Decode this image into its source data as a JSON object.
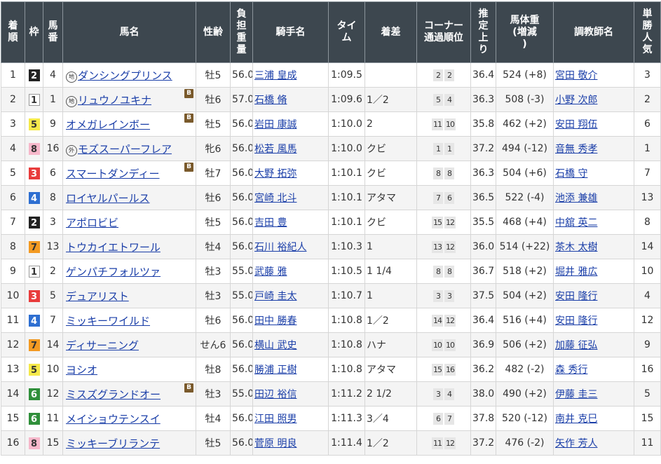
{
  "headers": {
    "rank": "着順",
    "frame": "枠",
    "number": "馬番",
    "horse": "馬名",
    "sex_age": "性齢",
    "weight": "負担重量",
    "jockey": "騎手名",
    "time": "タイム",
    "margin": "着差",
    "corner": "コーナー通過順位",
    "last3f": "推定上り",
    "body_weight": "馬体重(増減)",
    "trainer": "調教師名",
    "popularity": "単勝人気"
  },
  "frame_colors": {
    "1": {
      "bg": "#ffffff",
      "fg": "#333333",
      "border": "#999999"
    },
    "2": {
      "bg": "#222222",
      "fg": "#ffffff",
      "border": "#222222"
    },
    "3": {
      "bg": "#e83c3c",
      "fg": "#ffffff",
      "border": "#e83c3c"
    },
    "4": {
      "bg": "#2e6fd1",
      "fg": "#ffffff",
      "border": "#2e6fd1"
    },
    "5": {
      "bg": "#f5e94a",
      "fg": "#333333",
      "border": "#f5e94a"
    },
    "6": {
      "bg": "#2f8f3a",
      "fg": "#ffffff",
      "border": "#2f8f3a"
    },
    "7": {
      "bg": "#f39a22",
      "fg": "#333333",
      "border": "#f39a22"
    },
    "8": {
      "bg": "#f7b8cb",
      "fg": "#333333",
      "border": "#f7b8cb"
    }
  },
  "rows": [
    {
      "rank": "1",
      "frame": "2",
      "number": "4",
      "mark": "地",
      "horse": "ダンシングプリンス",
      "blinker": "",
      "sex_age": "牡5",
      "weight": "56.0",
      "jockey": "三浦 皇成",
      "time": "1:09.5",
      "margin": "",
      "corner": [
        "2",
        "2"
      ],
      "last3f": "36.4",
      "body_weight": "524 (+8)",
      "trainer": "宮田 敬介",
      "popularity": "3"
    },
    {
      "rank": "2",
      "frame": "1",
      "number": "1",
      "mark": "地",
      "horse": "リュウノユキナ",
      "blinker": "B",
      "sex_age": "牡6",
      "weight": "57.0",
      "jockey": "石橋 脩",
      "time": "1:09.6",
      "margin": "1／2",
      "corner": [
        "5",
        "4"
      ],
      "last3f": "36.3",
      "body_weight": "508 (-3)",
      "trainer": "小野 次郎",
      "popularity": "2"
    },
    {
      "rank": "3",
      "frame": "5",
      "number": "9",
      "mark": "",
      "horse": "オメガレインボー",
      "blinker": "B",
      "sex_age": "牡5",
      "weight": "56.0",
      "jockey": "岩田 康誠",
      "time": "1:10.0",
      "margin": "2",
      "corner": [
        "11",
        "10"
      ],
      "last3f": "35.8",
      "body_weight": "462 (+2)",
      "trainer": "安田 翔伍",
      "popularity": "6"
    },
    {
      "rank": "4",
      "frame": "8",
      "number": "16",
      "mark": "外",
      "horse": "モズスーパーフレア",
      "blinker": "",
      "sex_age": "牝6",
      "weight": "56.0",
      "jockey": "松若 風馬",
      "time": "1:10.0",
      "margin": "クビ",
      "corner": [
        "1",
        "1"
      ],
      "last3f": "37.2",
      "body_weight": "494 (-12)",
      "trainer": "音無 秀孝",
      "popularity": "1"
    },
    {
      "rank": "5",
      "frame": "3",
      "number": "6",
      "mark": "",
      "horse": "スマートダンディー",
      "blinker": "B",
      "sex_age": "牡7",
      "weight": "56.0",
      "jockey": "大野 拓弥",
      "time": "1:10.1",
      "margin": "クビ",
      "corner": [
        "8",
        "8"
      ],
      "last3f": "36.3",
      "body_weight": "504 (+6)",
      "trainer": "石橋 守",
      "popularity": "7"
    },
    {
      "rank": "6",
      "frame": "4",
      "number": "8",
      "mark": "",
      "horse": "ロイヤルパールス",
      "blinker": "",
      "sex_age": "牡6",
      "weight": "56.0",
      "jockey": "宮崎 北斗",
      "time": "1:10.1",
      "margin": "アタマ",
      "corner": [
        "7",
        "6"
      ],
      "last3f": "36.5",
      "body_weight": "522 (-4)",
      "trainer": "池添 兼雄",
      "popularity": "13"
    },
    {
      "rank": "7",
      "frame": "2",
      "number": "3",
      "mark": "",
      "horse": "アポロビビ",
      "blinker": "",
      "sex_age": "牡5",
      "weight": "56.0",
      "jockey": "吉田 豊",
      "time": "1:10.1",
      "margin": "クビ",
      "corner": [
        "15",
        "12"
      ],
      "last3f": "35.5",
      "body_weight": "468 (+4)",
      "trainer": "中舘 英二",
      "popularity": "8"
    },
    {
      "rank": "8",
      "frame": "7",
      "number": "13",
      "mark": "",
      "horse": "トウカイエトワール",
      "blinker": "",
      "sex_age": "牡4",
      "weight": "56.0",
      "jockey": "石川 裕紀人",
      "time": "1:10.3",
      "margin": "1",
      "corner": [
        "13",
        "12"
      ],
      "last3f": "36.0",
      "body_weight": "514 (+22)",
      "trainer": "茶木 太樹",
      "popularity": "14"
    },
    {
      "rank": "9",
      "frame": "1",
      "number": "2",
      "mark": "",
      "horse": "ゲンパチフォルツァ",
      "blinker": "",
      "sex_age": "牡3",
      "weight": "55.0",
      "jockey": "武藤 雅",
      "time": "1:10.5",
      "margin": "1 1/4",
      "corner": [
        "8",
        "8"
      ],
      "last3f": "36.7",
      "body_weight": "518 (+2)",
      "trainer": "堀井 雅広",
      "popularity": "10"
    },
    {
      "rank": "10",
      "frame": "3",
      "number": "5",
      "mark": "",
      "horse": "デュアリスト",
      "blinker": "",
      "sex_age": "牡3",
      "weight": "55.0",
      "jockey": "戸崎 圭太",
      "time": "1:10.7",
      "margin": "1",
      "corner": [
        "3",
        "3"
      ],
      "last3f": "37.5",
      "body_weight": "504 (+2)",
      "trainer": "安田 隆行",
      "popularity": "4"
    },
    {
      "rank": "11",
      "frame": "4",
      "number": "7",
      "mark": "",
      "horse": "ミッキーワイルド",
      "blinker": "",
      "sex_age": "牡6",
      "weight": "56.0",
      "jockey": "田中 勝春",
      "time": "1:10.8",
      "margin": "1／2",
      "corner": [
        "14",
        "12"
      ],
      "last3f": "36.4",
      "body_weight": "516 (+4)",
      "trainer": "安田 隆行",
      "popularity": "12"
    },
    {
      "rank": "12",
      "frame": "7",
      "number": "14",
      "mark": "",
      "horse": "ディサーニング",
      "blinker": "",
      "sex_age": "せん6",
      "weight": "56.0",
      "jockey": "横山 武史",
      "time": "1:10.8",
      "margin": "ハナ",
      "corner": [
        "10",
        "10"
      ],
      "last3f": "36.9",
      "body_weight": "506 (+2)",
      "trainer": "加藤 征弘",
      "popularity": "9"
    },
    {
      "rank": "13",
      "frame": "5",
      "number": "10",
      "mark": "",
      "horse": "ヨシオ",
      "blinker": "",
      "sex_age": "牡8",
      "weight": "56.0",
      "jockey": "勝浦 正樹",
      "time": "1:10.8",
      "margin": "アタマ",
      "corner": [
        "15",
        "16"
      ],
      "last3f": "36.2",
      "body_weight": "482 (-2)",
      "trainer": "森 秀行",
      "popularity": "16"
    },
    {
      "rank": "14",
      "frame": "6",
      "number": "12",
      "mark": "",
      "horse": "ミスズグランドオー",
      "blinker": "B",
      "sex_age": "牡3",
      "weight": "55.0",
      "jockey": "田辺 裕信",
      "time": "1:11.2",
      "margin": "2 1/2",
      "corner": [
        "3",
        "4"
      ],
      "last3f": "38.0",
      "body_weight": "490 (+2)",
      "trainer": "伊藤 圭三",
      "popularity": "5"
    },
    {
      "rank": "15",
      "frame": "6",
      "number": "11",
      "mark": "",
      "horse": "メイショウテンスイ",
      "blinker": "",
      "sex_age": "牡4",
      "weight": "56.0",
      "jockey": "江田 照男",
      "time": "1:11.3",
      "margin": "3／4",
      "corner": [
        "6",
        "7"
      ],
      "last3f": "37.8",
      "body_weight": "520 (-12)",
      "trainer": "南井 克巳",
      "popularity": "15"
    },
    {
      "rank": "16",
      "frame": "8",
      "number": "15",
      "mark": "",
      "horse": "ミッキーブリランテ",
      "blinker": "",
      "sex_age": "牡5",
      "weight": "56.0",
      "jockey": "菅原 明良",
      "time": "1:11.4",
      "margin": "1／2",
      "corner": [
        "11",
        "12"
      ],
      "last3f": "37.2",
      "body_weight": "476 (-2)",
      "trainer": "矢作 芳人",
      "popularity": "11"
    }
  ]
}
